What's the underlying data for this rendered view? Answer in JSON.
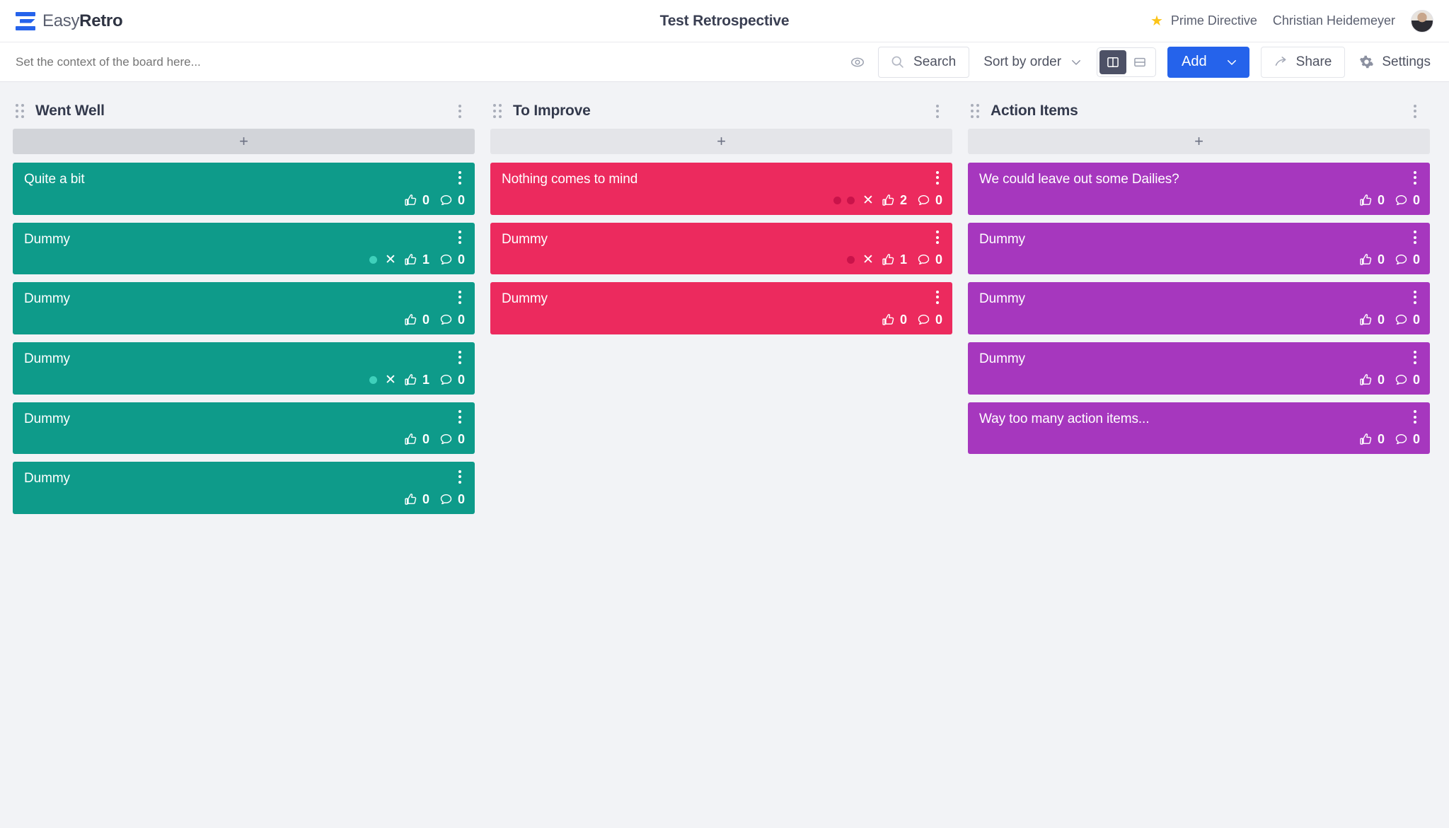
{
  "header": {
    "brand_easy": "Easy",
    "brand_retro": "Retro",
    "board_title": "Test Retrospective",
    "prime_directive": "Prime Directive",
    "user_name": "Christian Heidemeyer"
  },
  "toolbar": {
    "context_placeholder": "Set the context of the board here...",
    "context_value": "",
    "search_label": "Search",
    "sort_label": "Sort by order",
    "add_label": "Add",
    "share_label": "Share",
    "settings_label": "Settings",
    "view_mode": "columns",
    "accent_color": "#2563eb"
  },
  "columns": [
    {
      "title": "Went Well",
      "color": "#0e9b8a",
      "dot_color": "#3fd0bb",
      "add_hover": true,
      "cards": [
        {
          "text": "Quite a bit",
          "group_dots": 0,
          "votes": "0",
          "comments": "0",
          "merged": false
        },
        {
          "text": "Dummy",
          "group_dots": 1,
          "votes": "1",
          "comments": "0",
          "merged": true
        },
        {
          "text": "Dummy",
          "group_dots": 0,
          "votes": "0",
          "comments": "0",
          "merged": false
        },
        {
          "text": "Dummy",
          "group_dots": 1,
          "votes": "1",
          "comments": "0",
          "merged": true
        },
        {
          "text": "Dummy",
          "group_dots": 0,
          "votes": "0",
          "comments": "0",
          "merged": false
        },
        {
          "text": "Dummy",
          "group_dots": 0,
          "votes": "0",
          "comments": "0",
          "merged": false
        }
      ]
    },
    {
      "title": "To Improve",
      "color": "#ec2a5e",
      "dot_color": "#c9134a",
      "add_hover": false,
      "cards": [
        {
          "text": "Nothing comes to mind",
          "group_dots": 2,
          "votes": "2",
          "comments": "0",
          "merged": true
        },
        {
          "text": "Dummy",
          "group_dots": 1,
          "votes": "1",
          "comments": "0",
          "merged": true
        },
        {
          "text": "Dummy",
          "group_dots": 0,
          "votes": "0",
          "comments": "0",
          "merged": false
        }
      ]
    },
    {
      "title": "Action Items",
      "color": "#a637be",
      "dot_color": "#cf7fe0",
      "add_hover": false,
      "cards": [
        {
          "text": "We could leave out some Dailies?",
          "group_dots": 0,
          "votes": "0",
          "comments": "0",
          "merged": false
        },
        {
          "text": "Dummy",
          "group_dots": 0,
          "votes": "0",
          "comments": "0",
          "merged": false
        },
        {
          "text": "Dummy",
          "group_dots": 0,
          "votes": "0",
          "comments": "0",
          "merged": false
        },
        {
          "text": "Dummy",
          "group_dots": 0,
          "votes": "0",
          "comments": "0",
          "merged": false
        },
        {
          "text": "Way too many action items...",
          "group_dots": 0,
          "votes": "0",
          "comments": "0",
          "merged": false
        }
      ]
    }
  ],
  "icons": {
    "star": "star-icon",
    "eye": "eye-icon",
    "search": "search-icon",
    "chevron": "chevron-down-icon",
    "columns_view": "columns-view-icon",
    "rows_view": "rows-view-icon",
    "share": "share-arrow-icon",
    "gear": "gear-icon",
    "thumbs_up": "thumbs-up-icon",
    "comment": "comment-bubble-icon",
    "plus": "plus-icon",
    "kebab": "kebab-menu-icon",
    "drag": "drag-handle-icon"
  }
}
